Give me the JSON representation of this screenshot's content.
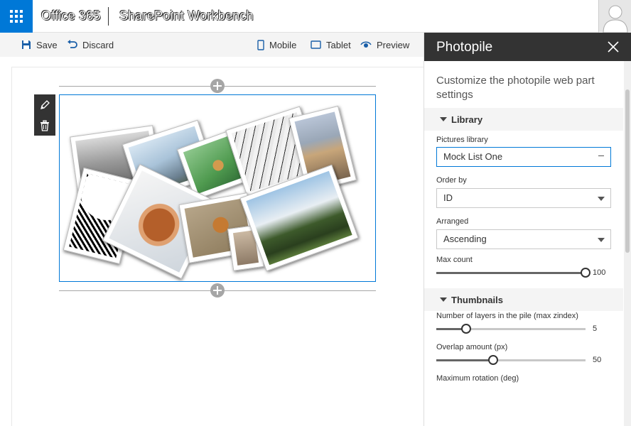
{
  "suitebar": {
    "product": "Office 365",
    "app": "SharePoint Workbench"
  },
  "commands": {
    "save": "Save",
    "discard": "Discard",
    "mobile": "Mobile",
    "tablet": "Tablet",
    "preview": "Preview"
  },
  "panel": {
    "title": "Photopile",
    "description": "Customize the photopile web part settings",
    "groups": {
      "library": "Library",
      "thumbnails": "Thumbnails"
    },
    "fields": {
      "pictures_library": {
        "label": "Pictures library",
        "value": "Mock List One"
      },
      "order_by": {
        "label": "Order by",
        "value": "ID"
      },
      "arranged": {
        "label": "Arranged",
        "value": "Ascending"
      },
      "max_count": {
        "label": "Max count",
        "value": "100",
        "fraction": 1.0
      },
      "layers": {
        "label": "Number of layers in the pile (max zindex)",
        "value": "5",
        "fraction": 0.2
      },
      "overlap": {
        "label": "Overlap amount (px)",
        "value": "50",
        "fraction": 0.38
      },
      "max_rotation": {
        "label": "Maximum rotation (deg)"
      }
    }
  },
  "colors": {
    "brand": "#0078d7",
    "panel_header": "#333333"
  }
}
